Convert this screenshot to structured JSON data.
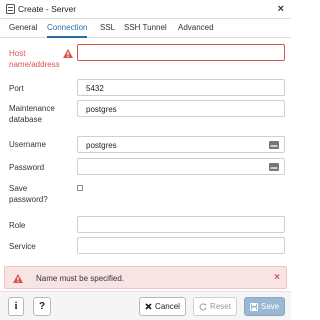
{
  "window": {
    "title": "Create - Server",
    "close_label": "×"
  },
  "tabs": [
    {
      "label": "General"
    },
    {
      "label": "Connection"
    },
    {
      "label": "SSL"
    },
    {
      "label": "SSH Tunnel"
    },
    {
      "label": "Advanced"
    }
  ],
  "active_tab": "Connection",
  "form": {
    "host": {
      "label_line1": "Host",
      "label_line2": "name/address",
      "value": ""
    },
    "port": {
      "label": "Port",
      "value": "5432"
    },
    "maintenance_db": {
      "label_line1": "Maintenance",
      "label_line2": "database",
      "value": "postgres"
    },
    "username": {
      "label": "Username",
      "value": "postgres"
    },
    "password": {
      "label": "Password",
      "value": ""
    },
    "save_password": {
      "label_line1": "Save",
      "label_line2": "password?",
      "checked": false
    },
    "role": {
      "label": "Role",
      "value": ""
    },
    "service": {
      "label": "Service",
      "value": ""
    }
  },
  "error": {
    "message": "Name must be specified.",
    "dismiss": "×"
  },
  "footer": {
    "info_label": "i",
    "help_label": "?",
    "cancel_label": "Cancel",
    "reset_label": "Reset",
    "save_label": "Save"
  },
  "colors": {
    "accent": "#2c6ba4",
    "error": "#d9534f",
    "error_bg": "#f8e4e4",
    "save_disabled": "#9ab7d3"
  },
  "icons": [
    "server-icon",
    "close-icon",
    "warning-icon",
    "key-icon",
    "times-icon",
    "refresh-icon",
    "save-icon"
  ]
}
